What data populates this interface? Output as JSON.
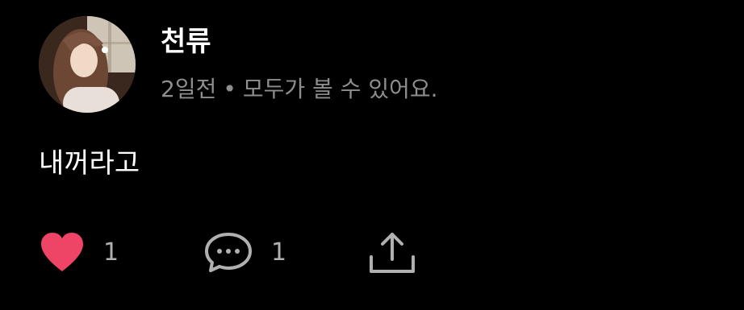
{
  "post": {
    "author": {
      "name": "천류",
      "avatar_icon": "profile-avatar"
    },
    "meta": {
      "time": "2일전",
      "separator": "•",
      "visibility": "모두가 볼 수 있어요."
    },
    "text": "내꺼라고",
    "actions": {
      "like": {
        "icon": "heart-icon",
        "count": "1",
        "color": "#ee4466"
      },
      "comment": {
        "icon": "comment-icon",
        "count": "1"
      },
      "share": {
        "icon": "share-icon"
      }
    }
  },
  "colors": {
    "background": "#000000",
    "primary_text": "#ffffff",
    "secondary_text": "#8e8e8e",
    "icon": "#b0b0b0",
    "like": "#ee4466"
  }
}
